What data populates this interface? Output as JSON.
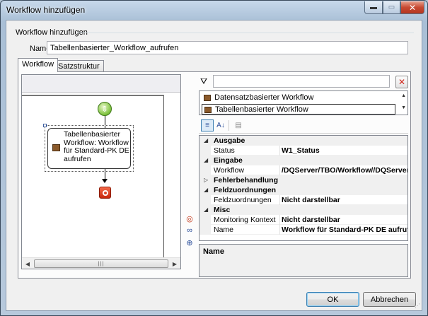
{
  "window": {
    "title": "Workflow hinzufügen",
    "min_label": "▬",
    "max_label": "▭",
    "close_label": "✕"
  },
  "group": {
    "legend": "Workflow hinzufügen"
  },
  "name_field": {
    "label": "Name",
    "value": "Tabellenbasierter_Workflow_aufrufen"
  },
  "tabs": [
    {
      "label": "Workflow",
      "active": true
    },
    {
      "label": "Satzstruktur",
      "active": false
    }
  ],
  "designer": {
    "task_label": "Tabellenbasierter Workflow: Workflow für Standard-PK DE aufrufen",
    "start_icon": "start-arrow-icon",
    "end_icon": "end-stop-icon",
    "scroll_grip": "|||"
  },
  "filter": {
    "icon": "filter-icon",
    "placeholder": "",
    "clear_label": "✕"
  },
  "workflow_list": [
    {
      "label": "Datensatzbasierter Workflow",
      "selected": false
    },
    {
      "label": "Tabellenbasierter Workflow",
      "selected": true
    }
  ],
  "prop_toolbar": {
    "categorized_label": "≡",
    "alpha_label": "A↓",
    "pages_label": "▤"
  },
  "properties": [
    {
      "type": "category",
      "label": "Ausgabe",
      "expanded": true
    },
    {
      "type": "prop",
      "key": "Status",
      "value": "W1_Status"
    },
    {
      "type": "category",
      "label": "Eingabe",
      "expanded": true
    },
    {
      "type": "prop",
      "key": "Workflow",
      "value": "/DQServer/TBO/Workflow//DQServer"
    },
    {
      "type": "category",
      "label": "Fehlerbehandlung",
      "expanded": false
    },
    {
      "type": "category",
      "label": "Feldzuordnungen",
      "expanded": true
    },
    {
      "type": "prop",
      "key": "Feldzuordnungen",
      "value": "Nicht darstellbar"
    },
    {
      "type": "category",
      "label": "Misc",
      "expanded": true
    },
    {
      "type": "prop",
      "key": "Monitoring Kontext",
      "value": "Nicht darstellbar"
    },
    {
      "type": "prop",
      "key": "Name",
      "value": "Workflow für Standard-PK DE aufrufen"
    }
  ],
  "description": {
    "title": "Name"
  },
  "buttons": {
    "ok": "OK",
    "cancel": "Abbrechen"
  },
  "colors": {
    "titlebar": "#b6c7d8",
    "close": "#c74a32",
    "start_node": "#7cc13c",
    "end_node": "#c8260b"
  }
}
